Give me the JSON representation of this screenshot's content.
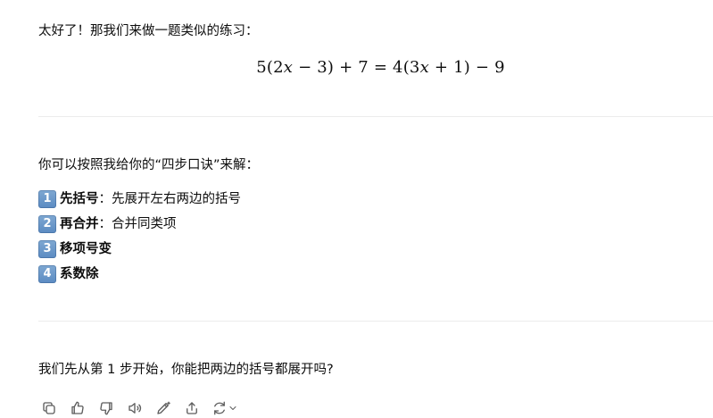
{
  "messages": {
    "intro": "太好了！那我们来做一题类似的练习：",
    "equation": {
      "parts": [
        "5(2",
        "x",
        " − 3) + 7 = 4(3",
        "x",
        " + 1) − 9"
      ]
    },
    "lead": "你可以按照我给你的“四步口诀”来解：",
    "steps": [
      {
        "num": "1",
        "title": "先括号",
        "desc": "：先展开左右两边的括号"
      },
      {
        "num": "2",
        "title": "再合并",
        "desc": "：合并同类项"
      },
      {
        "num": "3",
        "title": "移项号变",
        "desc": ""
      },
      {
        "num": "4",
        "title": "系数除",
        "desc": ""
      }
    ],
    "question": "我们先从第 1 步开始，你能把两边的括号都展开吗?"
  },
  "actions": [
    {
      "icon": "copy-icon"
    },
    {
      "icon": "thumbs-up-icon"
    },
    {
      "icon": "thumbs-down-icon"
    },
    {
      "icon": "read-aloud-icon"
    },
    {
      "icon": "edit-icon"
    },
    {
      "icon": "share-icon"
    },
    {
      "icon": "regenerate-icon"
    }
  ],
  "colors": {
    "text": "#0d0d0d",
    "icon": "#5d5d5d",
    "keycap": "#6a97c8",
    "divider": "#ececec"
  }
}
